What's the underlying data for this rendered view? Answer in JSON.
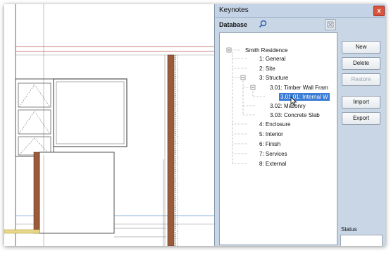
{
  "panel": {
    "title": "Keynotes",
    "close_glyph": "x",
    "database_label": "Database"
  },
  "tree": {
    "root": "Smith Residence",
    "items": [
      "1: General",
      "2: Site",
      "3: Structure",
      "3.01: Timber Wall Fram",
      "3.01.01: Internal W",
      "3.02: Masonry",
      "3.03: Concrete Slab",
      "4: Enclosure",
      "5: Interior",
      "6: Finish",
      "7: Services",
      "8: External"
    ],
    "selected_index": 4
  },
  "buttons": {
    "new": "New",
    "delete": "Delete",
    "restore": "Restore",
    "import": "Import",
    "export": "Export"
  },
  "status_label": "Status",
  "colors": {
    "panel_bg": "#c9d6e6",
    "selection": "#3a7bd5",
    "close": "#d9533d",
    "wall_brown": "#9b5a3a"
  },
  "icons": [
    "search-icon",
    "clear-search-icon",
    "close-icon",
    "collapse-icon"
  ]
}
